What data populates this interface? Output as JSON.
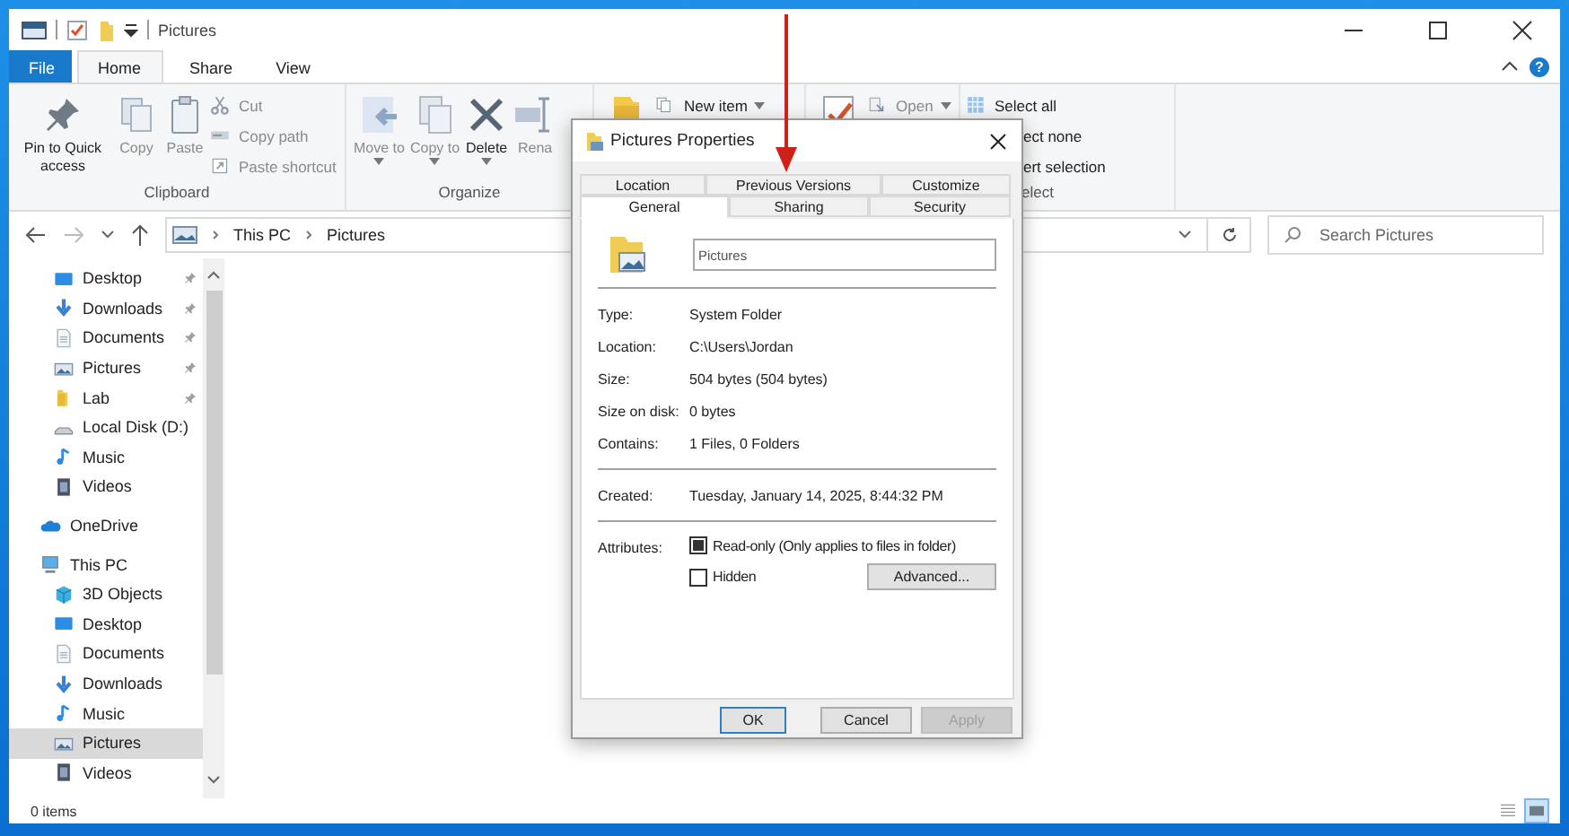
{
  "window": {
    "title": "Pictures"
  },
  "ribbon_tabs": [
    {
      "label": "File",
      "selected": false,
      "kind": "file"
    },
    {
      "label": "Home",
      "selected": true,
      "kind": "tab"
    },
    {
      "label": "Share",
      "selected": false,
      "kind": "tab"
    },
    {
      "label": "View",
      "selected": false,
      "kind": "tab"
    }
  ],
  "help_button": "?",
  "ribbon_groups": [
    {
      "label": "Clipboard",
      "large": [
        {
          "kind": "pin",
          "label": "Pin to Quick access",
          "disabled": false
        },
        {
          "kind": "copy",
          "label": "Copy",
          "disabled": true
        },
        {
          "kind": "paste",
          "label": "Paste",
          "disabled": true
        }
      ],
      "small": [
        {
          "kind": "cut",
          "label": "Cut",
          "disabled": true
        },
        {
          "kind": "copypath",
          "label": "Copy path",
          "disabled": true
        },
        {
          "kind": "shortcut",
          "label": "Paste shortcut",
          "disabled": true
        }
      ]
    },
    {
      "label": "Organize",
      "large": [
        {
          "kind": "move",
          "label": "Move to",
          "dropdown": true,
          "disabled": true
        },
        {
          "kind": "copyto",
          "label": "Copy to",
          "dropdown": true,
          "disabled": true
        },
        {
          "kind": "delete",
          "label": "Delete",
          "dropdown": true,
          "disabled": false
        },
        {
          "kind": "rename",
          "label": "Rena",
          "disabled": true
        }
      ]
    },
    {
      "large": [
        {
          "kind": "newfolder"
        }
      ],
      "small": [
        {
          "kind": "newitem",
          "label": "New item",
          "dropdown": true,
          "disabled": false
        }
      ]
    },
    {
      "large": [
        {
          "kind": "properties"
        }
      ],
      "small": [
        {
          "kind": "open",
          "label": "Open",
          "dropdown": true,
          "disabled": true
        }
      ]
    },
    {
      "label": "elect",
      "label_clipped": true,
      "small": [
        {
          "kind": "selectall",
          "label": "Select all",
          "disabled": false
        },
        {
          "label": "ect none",
          "clipped": true,
          "disabled": false
        },
        {
          "label": "ert selection",
          "clipped": true,
          "disabled": false
        }
      ]
    }
  ],
  "address_bar": {
    "crumbs": [
      "This PC",
      "Pictures"
    ]
  },
  "search": {
    "placeholder": "Search Pictures"
  },
  "quick_access": [
    {
      "label": "Desktop",
      "kind": "desktop",
      "pinned": true,
      "selected": false
    },
    {
      "label": "Downloads",
      "kind": "downloads",
      "pinned": true,
      "selected": false
    },
    {
      "label": "Documents",
      "kind": "documents",
      "pinned": true,
      "selected": false
    },
    {
      "label": "Pictures",
      "kind": "pictures",
      "pinned": true,
      "selected": false
    },
    {
      "label": "Lab",
      "kind": "folder",
      "pinned": true,
      "selected": false
    },
    {
      "label": "Local Disk (D:)",
      "kind": "drive",
      "pinned": false,
      "selected": false
    },
    {
      "label": "Music",
      "kind": "music",
      "pinned": false,
      "selected": false
    },
    {
      "label": "Videos",
      "kind": "videos",
      "pinned": false,
      "selected": false
    }
  ],
  "nav_tree": [
    {
      "label": "OneDrive",
      "kind": "cloud",
      "selected": false
    },
    {
      "label": "This PC",
      "kind": "pc",
      "selected": false,
      "children": [
        {
          "label": "3D Objects",
          "kind": "objects",
          "selected": false
        },
        {
          "label": "Desktop",
          "kind": "desktop",
          "selected": false
        },
        {
          "label": "Documents",
          "kind": "documents",
          "selected": false
        },
        {
          "label": "Downloads",
          "kind": "downloads",
          "selected": false
        },
        {
          "label": "Music",
          "kind": "music",
          "selected": false
        },
        {
          "label": "Pictures",
          "kind": "pictures",
          "selected": true
        },
        {
          "label": "Videos",
          "kind": "videos",
          "selected": false
        }
      ]
    }
  ],
  "status_bar": {
    "item_count": "0 items",
    "views": [
      {
        "kind": "details",
        "selected": false
      },
      {
        "kind": "large_icons",
        "selected": true
      }
    ]
  },
  "dialog": {
    "title": "Pictures Properties",
    "tab_rows": [
      [
        {
          "label": "Location",
          "selected": false
        },
        {
          "label": "Previous Versions",
          "selected": false
        },
        {
          "label": "Customize",
          "selected": false
        }
      ],
      [
        {
          "label": "General",
          "selected": true
        },
        {
          "label": "Sharing",
          "selected": false
        },
        {
          "label": "Security",
          "selected": false
        }
      ]
    ],
    "name_field": {
      "value": "Pictures"
    },
    "property_groups": [
      [
        {
          "label": "Type:",
          "value": "System Folder"
        },
        {
          "label": "Location:",
          "value": "C:\\Users\\Jordan"
        },
        {
          "label": "Size:",
          "value": "504 bytes (504 bytes)"
        },
        {
          "label": "Size on disk:",
          "value": "0 bytes"
        },
        {
          "label": "Contains:",
          "value": "1 Files, 0 Folders"
        }
      ],
      [
        {
          "label": "Created:",
          "value": "Tuesday, January 14, 2025, 8:44:32 PM"
        }
      ]
    ],
    "attributes_label": "Attributes:",
    "attributes": [
      {
        "label": "Read-only (Only applies to files in folder)",
        "checked": false,
        "indeterminate": true
      },
      {
        "label": "Hidden",
        "checked": false,
        "indeterminate": false
      }
    ],
    "advanced_button": "Advanced...",
    "buttons": [
      {
        "label": "OK",
        "default": true,
        "disabled": false
      },
      {
        "label": "Cancel",
        "default": false,
        "disabled": false
      },
      {
        "label": "Apply",
        "default": false,
        "disabled": true
      }
    ]
  }
}
